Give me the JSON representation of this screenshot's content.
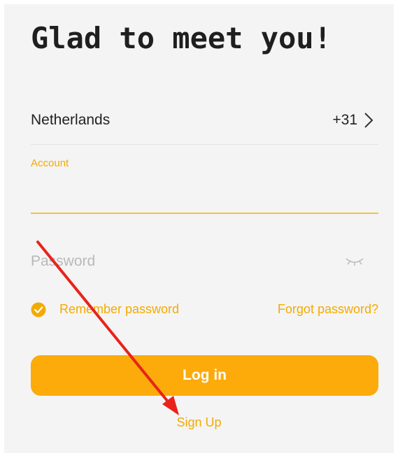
{
  "title": "Glad to meet you!",
  "country": {
    "name": "Netherlands",
    "code": "+31",
    "chevron_icon": "chevron-right-icon"
  },
  "account": {
    "label": "Account",
    "value": ""
  },
  "password": {
    "placeholder": "Password",
    "visibility_icon": "eye-closed-icon"
  },
  "remember": {
    "label": "Remember password",
    "checked": true,
    "icon": "check-circle-icon"
  },
  "forgot_label": "Forgot password?",
  "login_label": "Log in",
  "signup_label": "Sign Up",
  "colors": {
    "accent": "#fcab0b",
    "link": "#f3ab00",
    "annotation_arrow": "#e8231b"
  }
}
